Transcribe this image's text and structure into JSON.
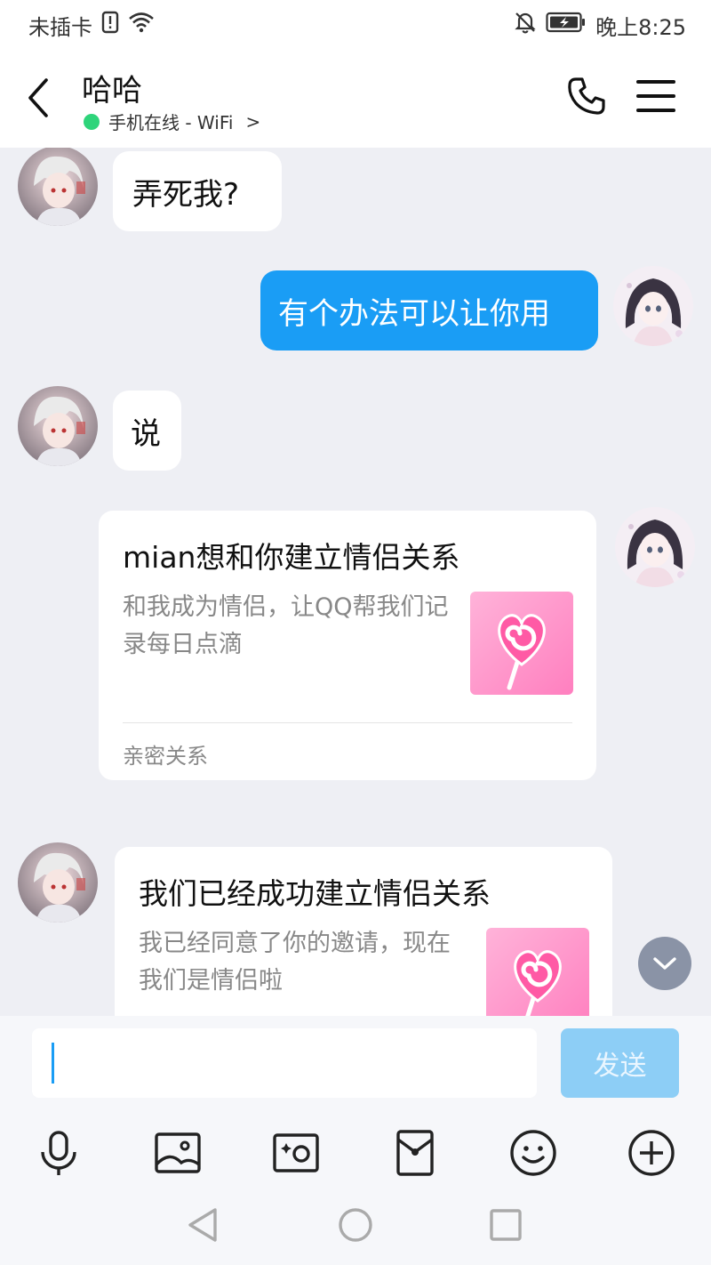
{
  "status_bar": {
    "carrier": "未插卡",
    "time": "晚上8:25"
  },
  "header": {
    "contact_name": "哈哈",
    "status_text": "手机在线 - WiFi",
    "status_chevron": ">"
  },
  "messages": [
    {
      "from": "them",
      "text": "弄死我?"
    },
    {
      "from": "me",
      "text": "有个办法可以让你用"
    },
    {
      "from": "them",
      "text": "说"
    }
  ],
  "card1": {
    "title": "mian想和你建立情侣关系",
    "desc": "和我成为情侣，让QQ帮我们记录每日点滴",
    "footer": "亲密关系"
  },
  "card2": {
    "title": "我们已经成功建立情侣关系",
    "desc": "我已经同意了你的邀请，现在我们是情侣啦"
  },
  "input": {
    "value": "",
    "send_label": "发送"
  },
  "toolbar_icons": [
    "microphone-icon",
    "image-icon",
    "camera-icon",
    "red-packet-icon",
    "emoji-icon",
    "plus-icon"
  ],
  "colors": {
    "accent": "#1a9df5",
    "send_disabled": "#8dcef6",
    "online": "#2ed47a",
    "background": "#eeeff4"
  }
}
